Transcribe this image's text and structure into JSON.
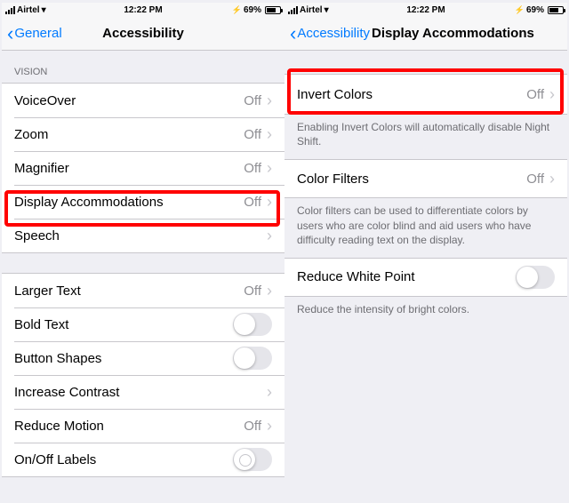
{
  "statusbar": {
    "carrier": "Airtel",
    "time": "12:22 PM",
    "battery_pct": "69%"
  },
  "left": {
    "back_label": "General",
    "title": "Accessibility",
    "vision_header": "VISION",
    "rows": {
      "voiceover": {
        "label": "VoiceOver",
        "value": "Off"
      },
      "zoom": {
        "label": "Zoom",
        "value": "Off"
      },
      "magnifier": {
        "label": "Magnifier",
        "value": "Off"
      },
      "display_acc": {
        "label": "Display Accommodations",
        "value": "Off"
      },
      "speech": {
        "label": "Speech"
      },
      "larger_text": {
        "label": "Larger Text",
        "value": "Off"
      },
      "bold_text": {
        "label": "Bold Text"
      },
      "button_shapes": {
        "label": "Button Shapes"
      },
      "increase_contrast": {
        "label": "Increase Contrast"
      },
      "reduce_motion": {
        "label": "Reduce Motion",
        "value": "Off"
      },
      "onoff_labels": {
        "label": "On/Off Labels"
      }
    }
  },
  "right": {
    "back_label": "Accessibility",
    "title": "Display Accommodations",
    "rows": {
      "invert": {
        "label": "Invert Colors",
        "value": "Off"
      },
      "invert_footer": "Enabling Invert Colors will automatically disable Night Shift.",
      "color_filters": {
        "label": "Color Filters",
        "value": "Off"
      },
      "color_filters_footer": "Color filters can be used to differentiate colors by users who are color blind and aid users who have difficulty reading text on the display.",
      "reduce_white": {
        "label": "Reduce White Point"
      },
      "reduce_white_footer": "Reduce the intensity of bright colors."
    }
  }
}
